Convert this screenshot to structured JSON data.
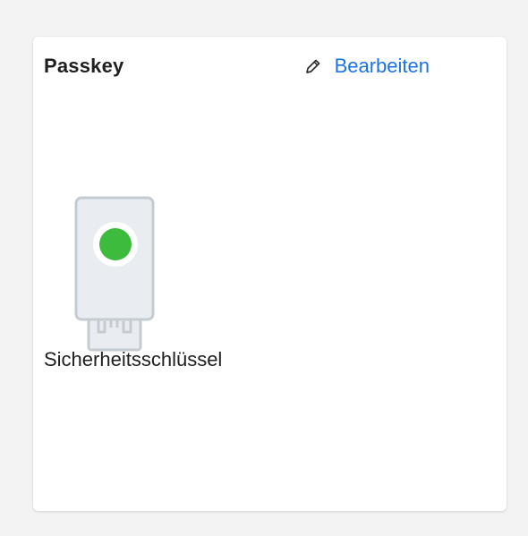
{
  "passkey_card": {
    "title": "Passkey",
    "edit_label": "Bearbeiten",
    "device_label": "Sicherheitsschlüssel",
    "icons": {
      "edit": "pencil-icon",
      "device": "security-key-icon"
    },
    "colors": {
      "link": "#1a73e8",
      "status_light": "#3dbb3d",
      "card_background": "#ffffff",
      "page_background": "#f3f3f3"
    }
  }
}
